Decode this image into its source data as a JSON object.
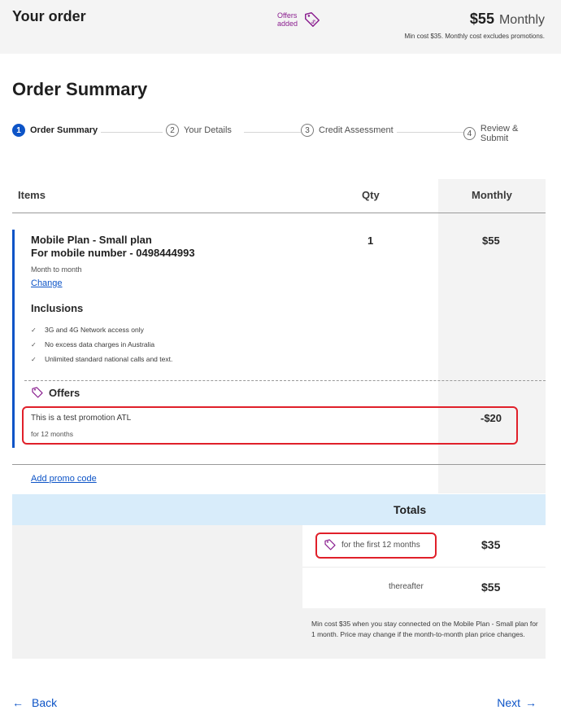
{
  "header": {
    "title": "Your order",
    "offers_added": "Offers added",
    "price": "$55",
    "price_period": "Monthly",
    "min_cost": "Min cost $35. Monthly cost excludes promotions."
  },
  "page_title": "Order Summary",
  "steps": [
    {
      "num": "1",
      "label": "Order Summary",
      "active": true
    },
    {
      "num": "2",
      "label": "Your Details",
      "active": false
    },
    {
      "num": "3",
      "label": "Credit Assessment",
      "active": false
    },
    {
      "num": "4",
      "label": "Review & Submit",
      "active": false
    }
  ],
  "table": {
    "col_items": "Items",
    "col_qty": "Qty",
    "col_monthly": "Monthly"
  },
  "item": {
    "plan_line1": "Mobile Plan - Small plan",
    "plan_line2": "For mobile number - 0498444993",
    "qty": "1",
    "monthly": "$55",
    "term": "Month to month",
    "change_label": "Change",
    "inclusions_heading": "Inclusions",
    "inclusions": [
      "3G and 4G Network access only",
      "No excess data charges in Australia",
      "Unlimited standard national calls and text."
    ]
  },
  "offers": {
    "heading": "Offers",
    "promo_name": "This is a test promotion ATL",
    "promo_duration": "for 12 months",
    "promo_amount": "-$20"
  },
  "add_promo_label": "Add promo code",
  "totals": {
    "heading": "Totals",
    "first_label": "for the first 12 months",
    "first_amount": "$35",
    "thereafter_label": "thereafter",
    "thereafter_amount": "$55",
    "min_note": "Min cost $35 when you stay connected on the Mobile Plan - Small plan for 1 month. Price may change if the month-to-month plan price changes."
  },
  "nav": {
    "back_label": "Back",
    "next_label": "Next"
  },
  "colors": {
    "accent_blue": "#0d54c7",
    "offer_purple": "#8a1f8f",
    "highlight_red": "#e0202a"
  }
}
